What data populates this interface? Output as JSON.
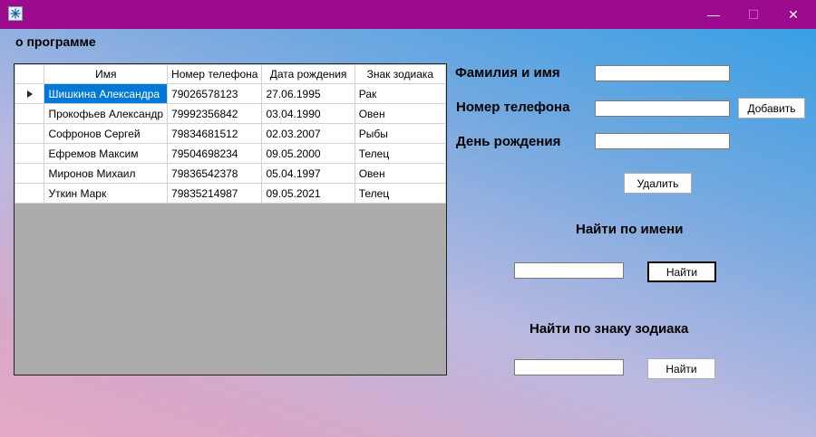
{
  "window": {
    "title": "",
    "colors": {
      "titlebar": "#9c0a8e",
      "selection": "#0078d7",
      "grid_background": "#ababab"
    },
    "controls": {
      "minimize": "—",
      "maximize": "☐",
      "close": "✕"
    }
  },
  "menu": {
    "about_label": "о программе"
  },
  "table": {
    "columns": [
      "Имя",
      "Номер телефона",
      "Дата рождения",
      "Знак зодиака"
    ],
    "rows": [
      [
        "Шишкина Александра",
        "79026578123",
        "27.06.1995",
        "Рак"
      ],
      [
        "Прокофьев Александр",
        "79992356842",
        "03.04.1990",
        "Овен"
      ],
      [
        "Софронов Сергей",
        "79834681512",
        "02.03.2007",
        "Рыбы"
      ],
      [
        "Ефремов Максим",
        "79504698234",
        "09.05.2000",
        "Телец"
      ],
      [
        "Миронов Михаил",
        "79836542378",
        "05.04.1997",
        "Овен"
      ],
      [
        "Уткин Марк",
        "79835214987",
        "09.05.2021",
        "Телец"
      ]
    ]
  },
  "form": {
    "name_label": "Фамилия и имя",
    "name_value": "",
    "phone_label": "Номер телефона",
    "phone_value": "",
    "birthday_label": "День рождения",
    "birthday_value": "",
    "add_label": "Добавить",
    "delete_label": "Удалить"
  },
  "search_name": {
    "heading": "Найти по имени",
    "value": "",
    "button_label": "Найти"
  },
  "search_zodiac": {
    "heading": "Найти по знаку зодиака",
    "value": "",
    "button_label": "Найти"
  }
}
